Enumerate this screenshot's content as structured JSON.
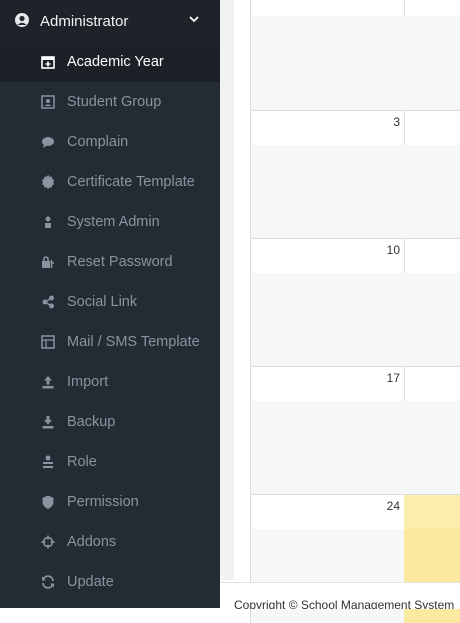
{
  "sidebar": {
    "header": {
      "title": "Administrator",
      "icon": "user-avatar-icon"
    },
    "items": [
      {
        "label": "Academic Year",
        "icon": "calendar-icon",
        "active": true
      },
      {
        "label": "Student Group",
        "icon": "group-icon"
      },
      {
        "label": "Complain",
        "icon": "chat-icon"
      },
      {
        "label": "Certificate Template",
        "icon": "certificate-icon"
      },
      {
        "label": "System Admin",
        "icon": "admin-icon"
      },
      {
        "label": "Reset Password",
        "icon": "lock-key-icon"
      },
      {
        "label": "Social Link",
        "icon": "share-icon"
      },
      {
        "label": "Mail / SMS Template",
        "icon": "template-icon"
      },
      {
        "label": "Import",
        "icon": "upload-icon"
      },
      {
        "label": "Backup",
        "icon": "download-icon"
      },
      {
        "label": "Role",
        "icon": "role-icon"
      },
      {
        "label": "Permission",
        "icon": "shield-icon"
      },
      {
        "label": "Addons",
        "icon": "crosshair-icon"
      },
      {
        "label": "Update",
        "icon": "refresh-icon"
      }
    ]
  },
  "calendar": {
    "day_numbers": [
      "3",
      "10",
      "17",
      "24"
    ]
  },
  "footer": {
    "text": "Copyright © School Management System"
  }
}
